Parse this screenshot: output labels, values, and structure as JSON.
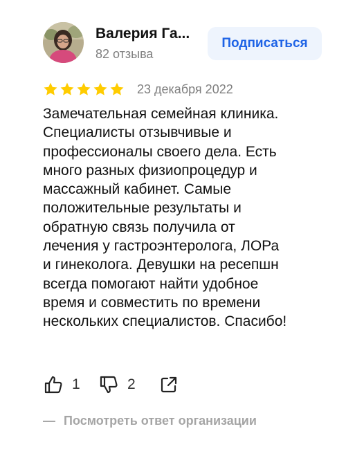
{
  "author": {
    "name": "Валерия Га...",
    "reviews_count": "82 отзыва"
  },
  "subscribe_label": "Подписаться",
  "rating": {
    "value": 5,
    "max": 5
  },
  "review": {
    "date": "23 декабря 2022",
    "lines": [
      "Замечательная семейная клиника.",
      "Специалисты отзывчивые и",
      "профессионалы своего дела. Есть",
      "много разных физиопроцедур и",
      "массажный кабинет. Самые",
      "положительные результаты и",
      "обратную связь получила от",
      "лечения у гастроэнтеролога, ЛОРа",
      "и гинеколога. Девушки на ресепшн",
      "всегда помогают найти удобное",
      "время и совместить по времени",
      "нескольких специалистов. Спасибо!"
    ]
  },
  "actions": {
    "likes": "1",
    "dislikes": "2",
    "like_icon": "thumbs-up-icon",
    "dislike_icon": "thumbs-down-icon",
    "share_icon": "share-icon"
  },
  "org_reply": {
    "dash": "—",
    "label": "Посмотреть ответ организации"
  },
  "colors": {
    "star": "#ffcc00",
    "subscribe_bg": "#eef4fd",
    "subscribe_text": "#1e63e6",
    "muted_text": "#7f7f7f"
  }
}
